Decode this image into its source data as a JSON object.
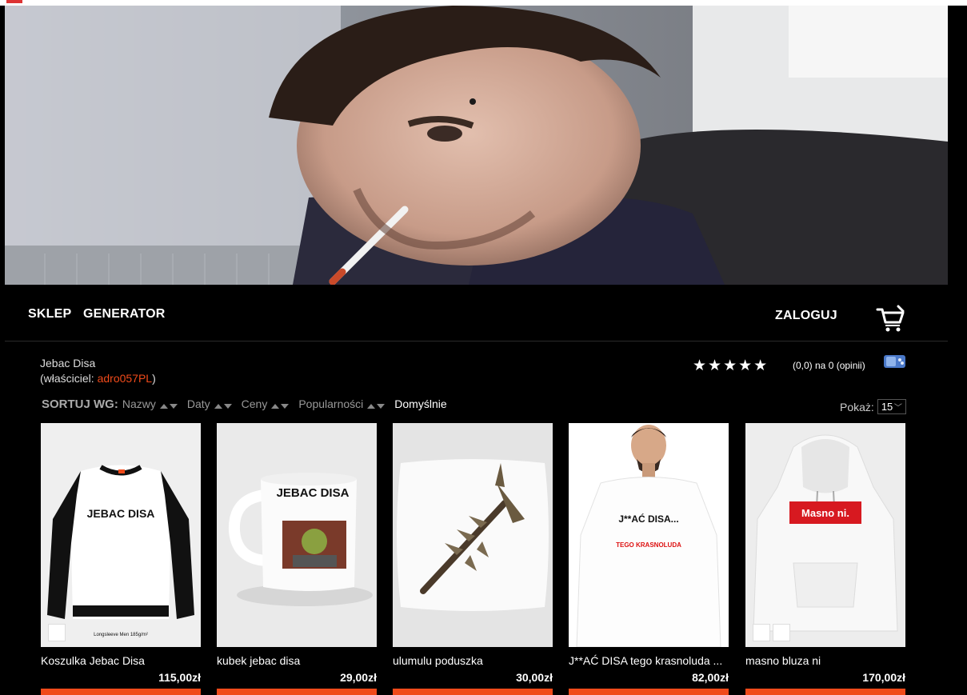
{
  "nav": {
    "shop": "SKLEP",
    "generator": "GENERATOR",
    "login": "ZALOGUJ"
  },
  "shop": {
    "name": "Jebac Disa",
    "owner_prefix": "(właściciel: ",
    "owner_name": "adro057PL",
    "owner_suffix": ")",
    "stars": "★★★★★",
    "rating_text": "(0,0) na 0 (opinii)"
  },
  "sort": {
    "label": "SORTUJ WG:",
    "options": [
      "Nazwy",
      "Daty",
      "Ceny",
      "Popularności"
    ],
    "default": "Domyślnie"
  },
  "show": {
    "label": "Pokaż:",
    "value": "15"
  },
  "products": [
    {
      "name": "Koszulka Jebac Disa",
      "price": "115,00zł",
      "print_text": "JEBAC DISA",
      "tag": "Longsleeve Men 185g/m²"
    },
    {
      "name": "kubek jebac disa",
      "price": "29,00zł",
      "print_text": "JEBAC DISA"
    },
    {
      "name": "ulumulu poduszka",
      "price": "30,00zł"
    },
    {
      "name": "J**AĆ DISA tego krasnoluda ...",
      "price": "82,00zł",
      "print_text": "J**AĆ DISA...",
      "print_sub": "TEGO KRASNOLUDA"
    },
    {
      "name": "masno bluza ni",
      "price": "170,00zł",
      "print_text": "Masno ni."
    }
  ],
  "colors": {
    "accent": "#f04a1a",
    "background": "#000000"
  }
}
